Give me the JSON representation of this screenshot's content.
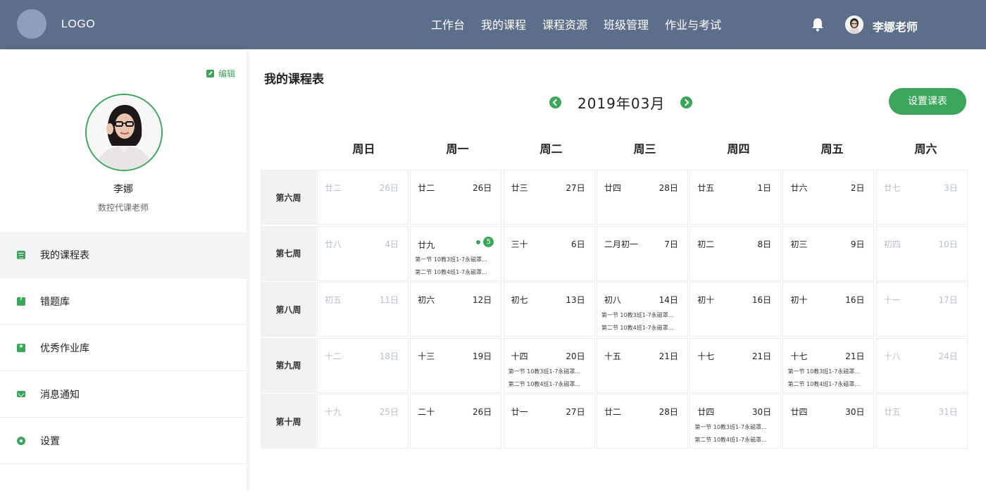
{
  "header": {
    "logo": "LOGO",
    "nav": [
      "工作台",
      "我的课程",
      "课程资源",
      "班级管理",
      "作业与考试"
    ],
    "user_name": "李娜老师",
    "bell_icon": "bell-icon"
  },
  "sidebar": {
    "edit": "编辑",
    "name": "李娜",
    "role": "数控代课老师",
    "menu": [
      {
        "label": "我的课程表",
        "icon": "calendar-icon"
      },
      {
        "label": "错题库",
        "icon": "question-book-icon"
      },
      {
        "label": "优秀作业库",
        "icon": "star-folder-icon"
      },
      {
        "label": "消息通知",
        "icon": "mail-icon"
      },
      {
        "label": "设置",
        "icon": "gear-icon"
      }
    ]
  },
  "main": {
    "title": "我的课程表",
    "month": "2019年03月",
    "set_button": "设置课表",
    "weekdays": [
      "周日",
      "周一",
      "周二",
      "周三",
      "周四",
      "周五",
      "周六"
    ],
    "weeks": [
      {
        "label": "第六周",
        "days": [
          {
            "lunar": "廿二",
            "solar": "26日",
            "faded": true
          },
          {
            "lunar": "廿二",
            "solar": "26日"
          },
          {
            "lunar": "廿三",
            "solar": "27日"
          },
          {
            "lunar": "廿四",
            "solar": "28日"
          },
          {
            "lunar": "廿五",
            "solar": "1日"
          },
          {
            "lunar": "廿六",
            "solar": "2日"
          },
          {
            "lunar": "廿七",
            "solar": "3日",
            "faded": true
          }
        ]
      },
      {
        "label": "第七周",
        "days": [
          {
            "lunar": "廿八",
            "solar": "4日",
            "faded": true
          },
          {
            "lunar": "廿九",
            "badge": "5",
            "lessons": [
              "第一节 10教3班1-7永磁罩...",
              "第二节 10教4班1-7永磁罩..."
            ]
          },
          {
            "lunar": "三十",
            "solar": "6日"
          },
          {
            "lunar": "二月初一",
            "solar": "7日"
          },
          {
            "lunar": "初二",
            "solar": "8日"
          },
          {
            "lunar": "初三",
            "solar": "9日"
          },
          {
            "lunar": "初四",
            "solar": "10日",
            "faded": true
          }
        ]
      },
      {
        "label": "第八周",
        "days": [
          {
            "lunar": "初五",
            "solar": "11日",
            "faded": true
          },
          {
            "lunar": "初六",
            "solar": "12日"
          },
          {
            "lunar": "初七",
            "solar": "13日"
          },
          {
            "lunar": "初八",
            "solar": "14日",
            "lessons": [
              "第一节 10教3班1-7永磁罩...",
              "第二节 10教4班1-7永磁罩..."
            ]
          },
          {
            "lunar": "初十",
            "solar": "16日"
          },
          {
            "lunar": "初十",
            "solar": "16日"
          },
          {
            "lunar": "十一",
            "solar": "17日",
            "faded": true
          }
        ]
      },
      {
        "label": "第九周",
        "days": [
          {
            "lunar": "十二",
            "solar": "18日",
            "faded": true
          },
          {
            "lunar": "十三",
            "solar": "19日"
          },
          {
            "lunar": "十四",
            "solar": "20日",
            "lessons": [
              "第一节 10教3班1-7永磁罩...",
              "第二节 10教4班1-7永磁罩..."
            ]
          },
          {
            "lunar": "十五",
            "solar": "21日"
          },
          {
            "lunar": "十七",
            "solar": "21日"
          },
          {
            "lunar": "十七",
            "solar": "21日",
            "lessons": [
              "第一节 10教3班1-7永磁罩...",
              "第二节 10教4班1-7永磁罩..."
            ]
          },
          {
            "lunar": "十八",
            "solar": "24日",
            "faded": true
          }
        ]
      },
      {
        "label": "第十周",
        "days": [
          {
            "lunar": "十九",
            "solar": "25日",
            "faded": true
          },
          {
            "lunar": "二十",
            "solar": "26日"
          },
          {
            "lunar": "廿一",
            "solar": "27日"
          },
          {
            "lunar": "廿二",
            "solar": "28日"
          },
          {
            "lunar": "廿四",
            "solar": "30日",
            "lessons": [
              "第一节 10教3班1-7永磁罩...",
              "第二节 10教4班1-7永磁罩..."
            ]
          },
          {
            "lunar": "廿四",
            "solar": "30日"
          },
          {
            "lunar": "廿五",
            "solar": "31日",
            "faded": true
          }
        ]
      }
    ]
  },
  "colors": {
    "header_bg": "#5c6e89",
    "accent": "#3ba55c",
    "faded_text": "#b8bfc8",
    "week_cell_bg": "#f2f2f2"
  }
}
